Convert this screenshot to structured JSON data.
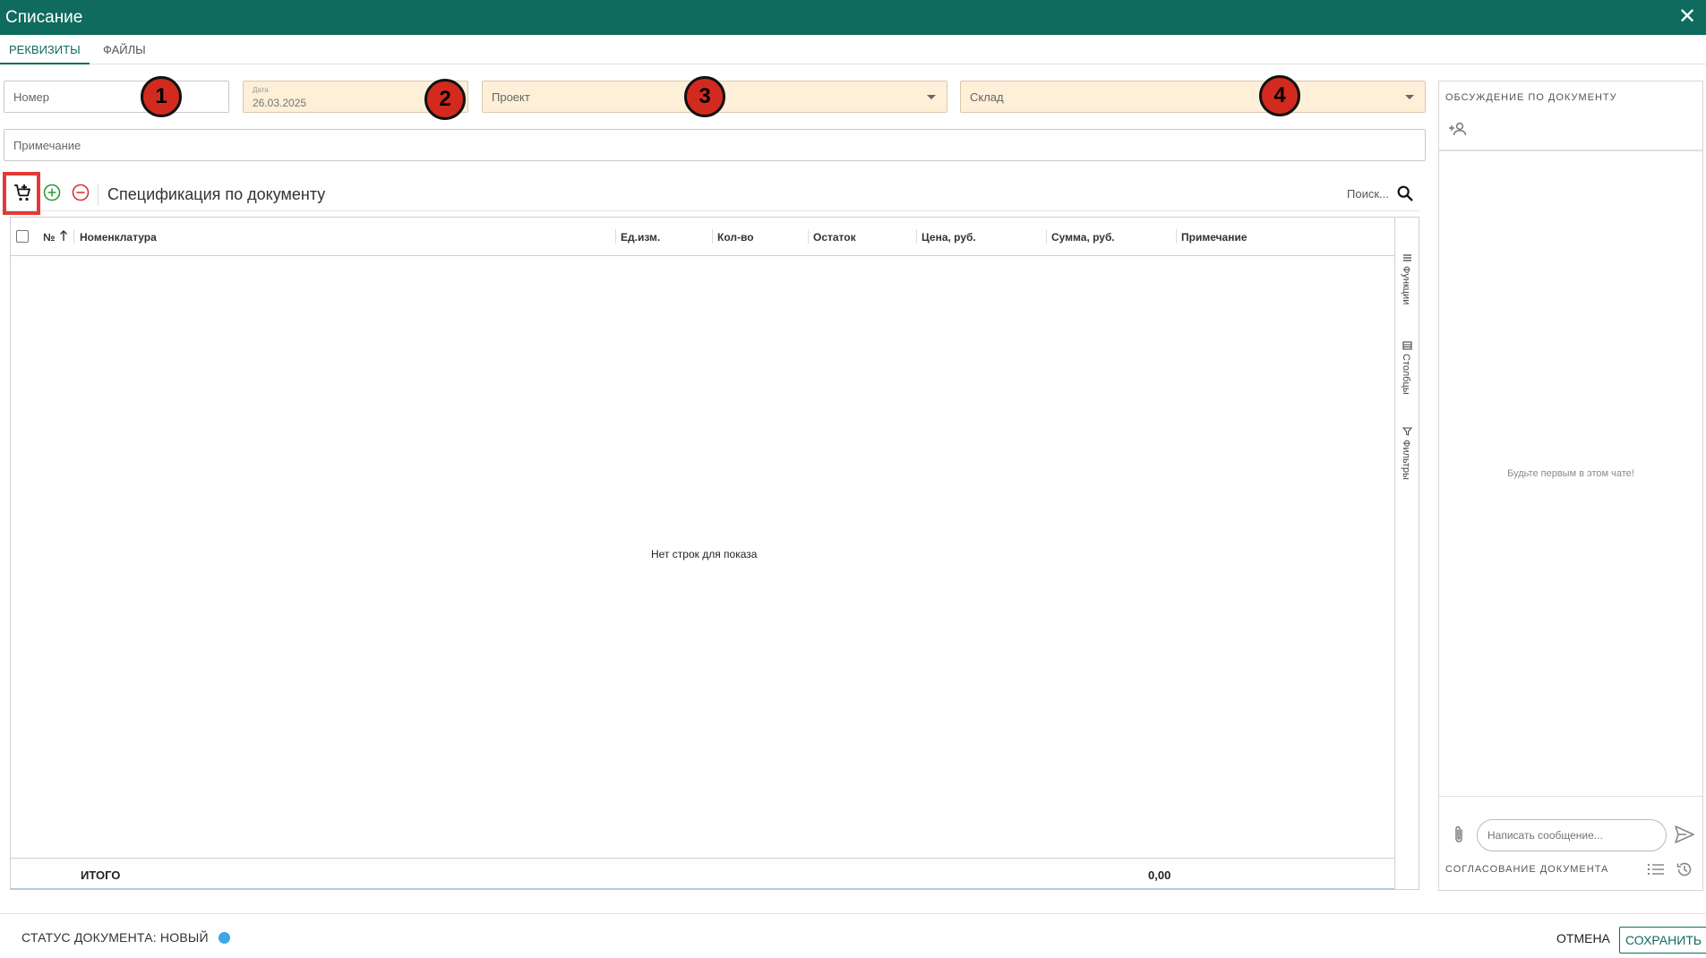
{
  "window": {
    "title": "Списание",
    "close_glyph": "✕"
  },
  "tabs": [
    {
      "label": "РЕКВИЗИТЫ",
      "active": true
    },
    {
      "label": "ФАЙЛЫ",
      "active": false
    }
  ],
  "form": {
    "number": {
      "placeholder": "Номер"
    },
    "date": {
      "label": "Дата",
      "value": "26.03.2025"
    },
    "project": {
      "placeholder": "Проект"
    },
    "warehouse": {
      "placeholder": "Склад"
    },
    "note": {
      "placeholder": "Примечание"
    }
  },
  "markers": [
    "1",
    "2",
    "3",
    "4"
  ],
  "spec": {
    "title": "Спецификация по документу",
    "search_placeholder": "Поиск...",
    "icons": [
      "cart-add-icon",
      "plus-circle-icon",
      "minus-circle-icon",
      "search-icon"
    ]
  },
  "grid": {
    "columns": [
      "№",
      "Номенклатура",
      "Ед.изм.",
      "Кол-во",
      "Остаток",
      "Цена, руб.",
      "Сумма, руб.",
      "Примечание"
    ],
    "side_tabs": [
      "Функции",
      "Столбцы",
      "Фильтры"
    ],
    "empty_text": "Нет строк для показа",
    "footer": {
      "label": "ИТОГО",
      "total": "0,00"
    }
  },
  "discussion": {
    "title": "ОБСУЖДЕНИЕ ПО ДОКУМЕНТУ",
    "empty_text": "Будьте первым в этом чате!",
    "message_placeholder": "Написать сообщение...",
    "approval_title": "СОГЛАСОВАНИЕ ДОКУМЕНТА"
  },
  "footer": {
    "status_text": "СТАТУС ДОКУМЕНТА: НОВЫЙ",
    "status_color": "#3fa6e6",
    "cancel_label": "ОТМЕНА",
    "save_label": "СОХРАНИТЬ"
  },
  "colors": {
    "brand": "#0f6b5e",
    "field_tint": "#fdefd8",
    "highlight": "#e53935",
    "marker": "#d32a1f"
  }
}
